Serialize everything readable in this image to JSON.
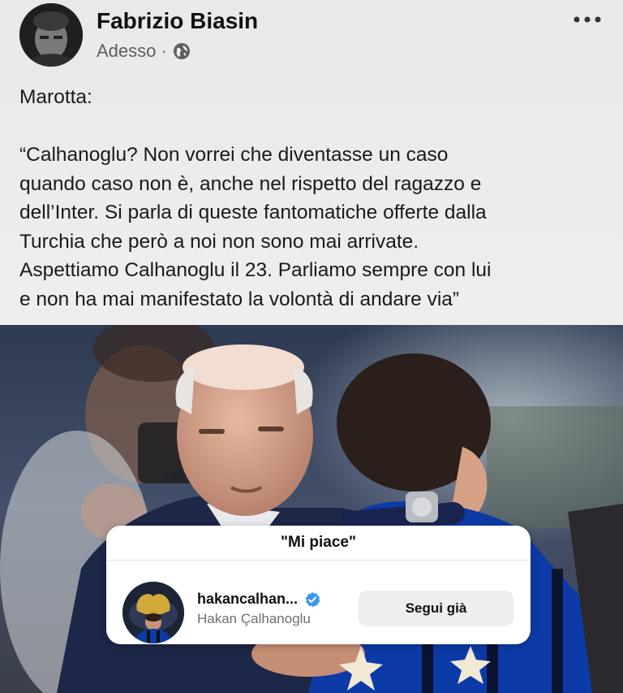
{
  "post": {
    "author_name": "Fabrizio Biasin",
    "timestamp": "Adesso",
    "separator": "·",
    "privacy_icon": "globe-icon",
    "more_icon": "more-horizontal-icon",
    "text_lines": [
      "Marotta:",
      "",
      "“Calhanoglu? Non vorrei che diventasse un caso",
      "quando caso non è, anche nel rispetto del ragazzo e",
      "dell’Inter. Si parla di queste fantomatiche offerte dalla",
      "Turchia che però a noi non sono mai arrivate.",
      "Aspettiamo Calhanoglu il 23. Parliamo sempre con lui",
      "e non ha mai manifestato la volontà di andare via”"
    ]
  },
  "likes_popup": {
    "title": "\"Mi piace\"",
    "liker": {
      "username": "hakancalhan...",
      "verified_icon": "verified-badge-icon",
      "full_name": "Hakan Çalhanoglu",
      "follow_label": "Segui già"
    }
  },
  "colors": {
    "verified_blue": "#3897f0",
    "inter_blue": "#0c3ba8"
  }
}
